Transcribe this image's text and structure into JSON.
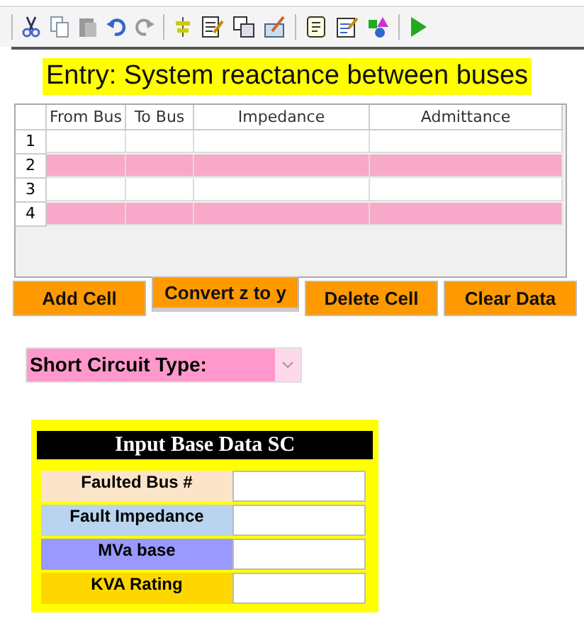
{
  "banner": {
    "title": "Entry: System reactance between buses"
  },
  "table": {
    "columns": [
      "From Bus",
      "To Bus",
      "Impedance",
      "Admittance"
    ],
    "rows": [
      {
        "number": "1",
        "highlighted": false
      },
      {
        "number": "2",
        "highlighted": true
      },
      {
        "number": "3",
        "highlighted": false
      },
      {
        "number": "4",
        "highlighted": true
      }
    ]
  },
  "buttons": [
    {
      "label": "Add Cell",
      "selected": false
    },
    {
      "label": "Convert z to y",
      "selected": true
    },
    {
      "label": "Delete Cell",
      "selected": false
    },
    {
      "label": "Clear Data",
      "selected": false
    }
  ],
  "dropdown": {
    "label": "Short Circuit Type:"
  },
  "panel": {
    "title": "Input Base Data SC",
    "fields": [
      {
        "label": "Faulted Bus #",
        "color": "#fce4c8"
      },
      {
        "label": "Fault Impedance",
        "color": "#b8d4ee"
      },
      {
        "label": "MVa base",
        "color": "#9999ff"
      },
      {
        "label": "KVA Rating",
        "color": "#ffd700"
      }
    ]
  }
}
